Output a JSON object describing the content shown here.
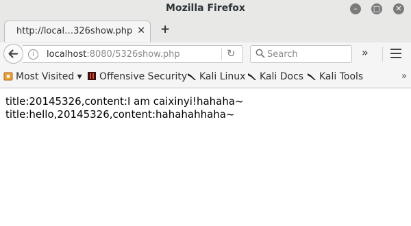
{
  "window": {
    "title": "Mozilla Firefox",
    "controls": [
      "minimize-icon",
      "maximize-icon",
      "close-icon"
    ]
  },
  "tab": {
    "label": "http://local…326show.php",
    "close": "✕"
  },
  "newtab": {
    "label": "+"
  },
  "navbar": {
    "url_host": "localhost",
    "url_rest": ":8080/5326show.php",
    "search_placeholder": "Search",
    "overflow": "»"
  },
  "bookmarks": {
    "items": [
      {
        "label": "Most Visited ▾",
        "icon": "gear-icon"
      },
      {
        "label": "Offensive Security",
        "icon": "offsec-icon"
      },
      {
        "label": "Kali Linux",
        "icon": "kali-dragon-icon"
      },
      {
        "label": "Kali Docs",
        "icon": "kali-dragon-icon"
      },
      {
        "label": "Kali Tools",
        "icon": "kali-dragon-icon"
      }
    ],
    "overflow": "»"
  },
  "content": {
    "lines": [
      "title:20145326,content:I am caixinyi!hahaha~",
      "title:hello,20145326,content:hahahahhaha~"
    ]
  },
  "colors": {
    "chrome": "#e8e8e7",
    "toolbar": "#f5f5f5",
    "window_button": "#7b7b7b"
  }
}
